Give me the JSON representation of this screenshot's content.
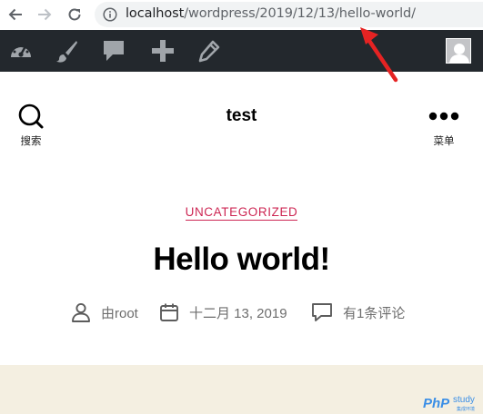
{
  "browser": {
    "url_host": "localhost",
    "url_path": "/wordpress/2019/12/13/hello-world/",
    "icons": [
      "back-icon",
      "forward-icon",
      "reload-icon",
      "info-icon"
    ]
  },
  "admin_bar": {
    "icons": [
      "dashboard-icon",
      "customize-brush-icon",
      "comments-icon",
      "new-content-icon",
      "edit-pencil-icon",
      "user-avatar"
    ]
  },
  "site_header": {
    "search_label": "搜索",
    "title": "test",
    "menu_label": "菜单"
  },
  "post": {
    "category": "UNCATEGORIZED",
    "title": "Hello world!",
    "author": "由root",
    "date": "十二月 13, 2019",
    "comments": "有1条评论"
  },
  "watermark": {
    "brand": "PhP",
    "sub": "study",
    "small": "集成环境"
  },
  "colors": {
    "admin_bar": "#23282d",
    "accent": "#cd2653",
    "beige": "#f4efe1",
    "annotation": "#e52323"
  }
}
